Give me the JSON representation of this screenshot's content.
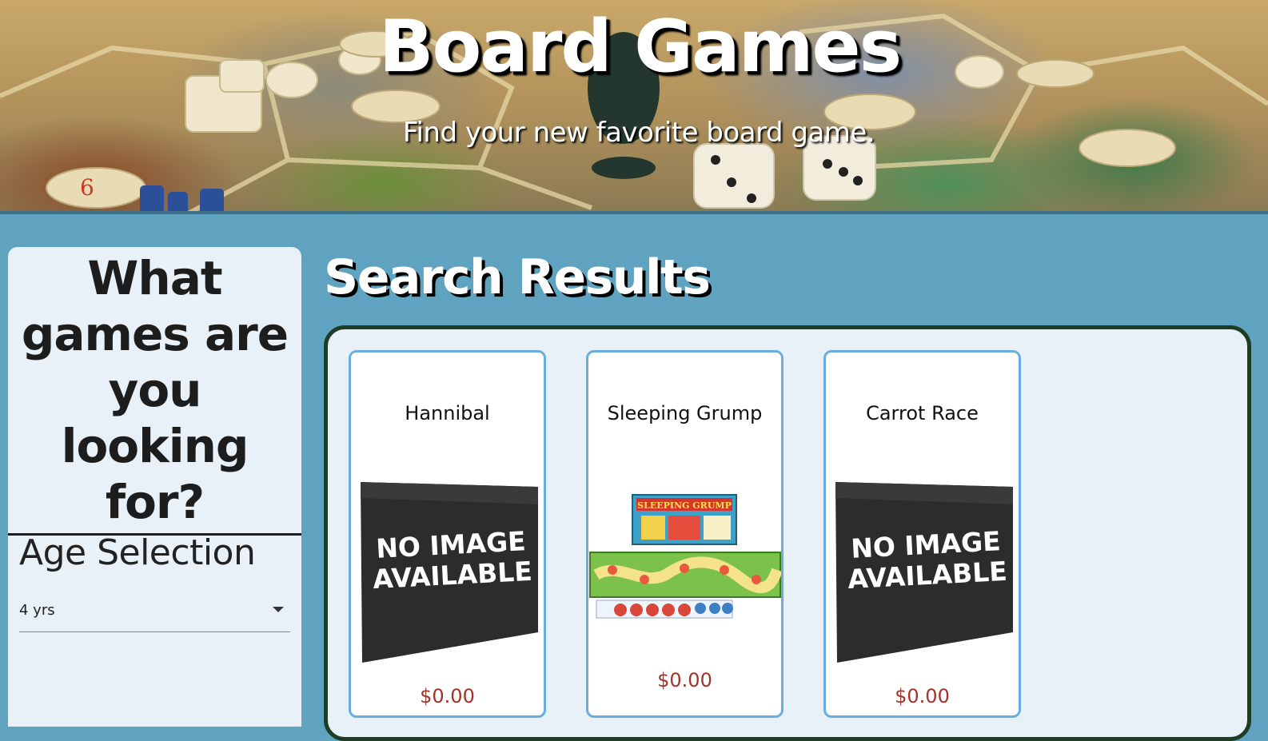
{
  "hero": {
    "title": "Board Games",
    "subtitle": "Find your new favorite board game."
  },
  "sidebar": {
    "heading": "What games are you looking for?",
    "age_selection": {
      "title": "Age Selection",
      "selected": "4 yrs"
    }
  },
  "main": {
    "title": "Search Results",
    "cards": [
      {
        "name": "Hannibal",
        "price": "$0.00",
        "image": "NO IMAGE AVAILABLE"
      },
      {
        "name": "Sleeping Grump",
        "price": "$0.00",
        "image": "SLEEPING GRUMP"
      },
      {
        "name": "Carrot Race",
        "price": "$0.00",
        "image": "NO IMAGE AVAILABLE"
      }
    ]
  },
  "colors": {
    "background": "#5fa3c0",
    "panel": "#e8f1f7",
    "panel_border": "#1f3c24",
    "card_border": "#6aaee0",
    "price": "#a0342a"
  }
}
